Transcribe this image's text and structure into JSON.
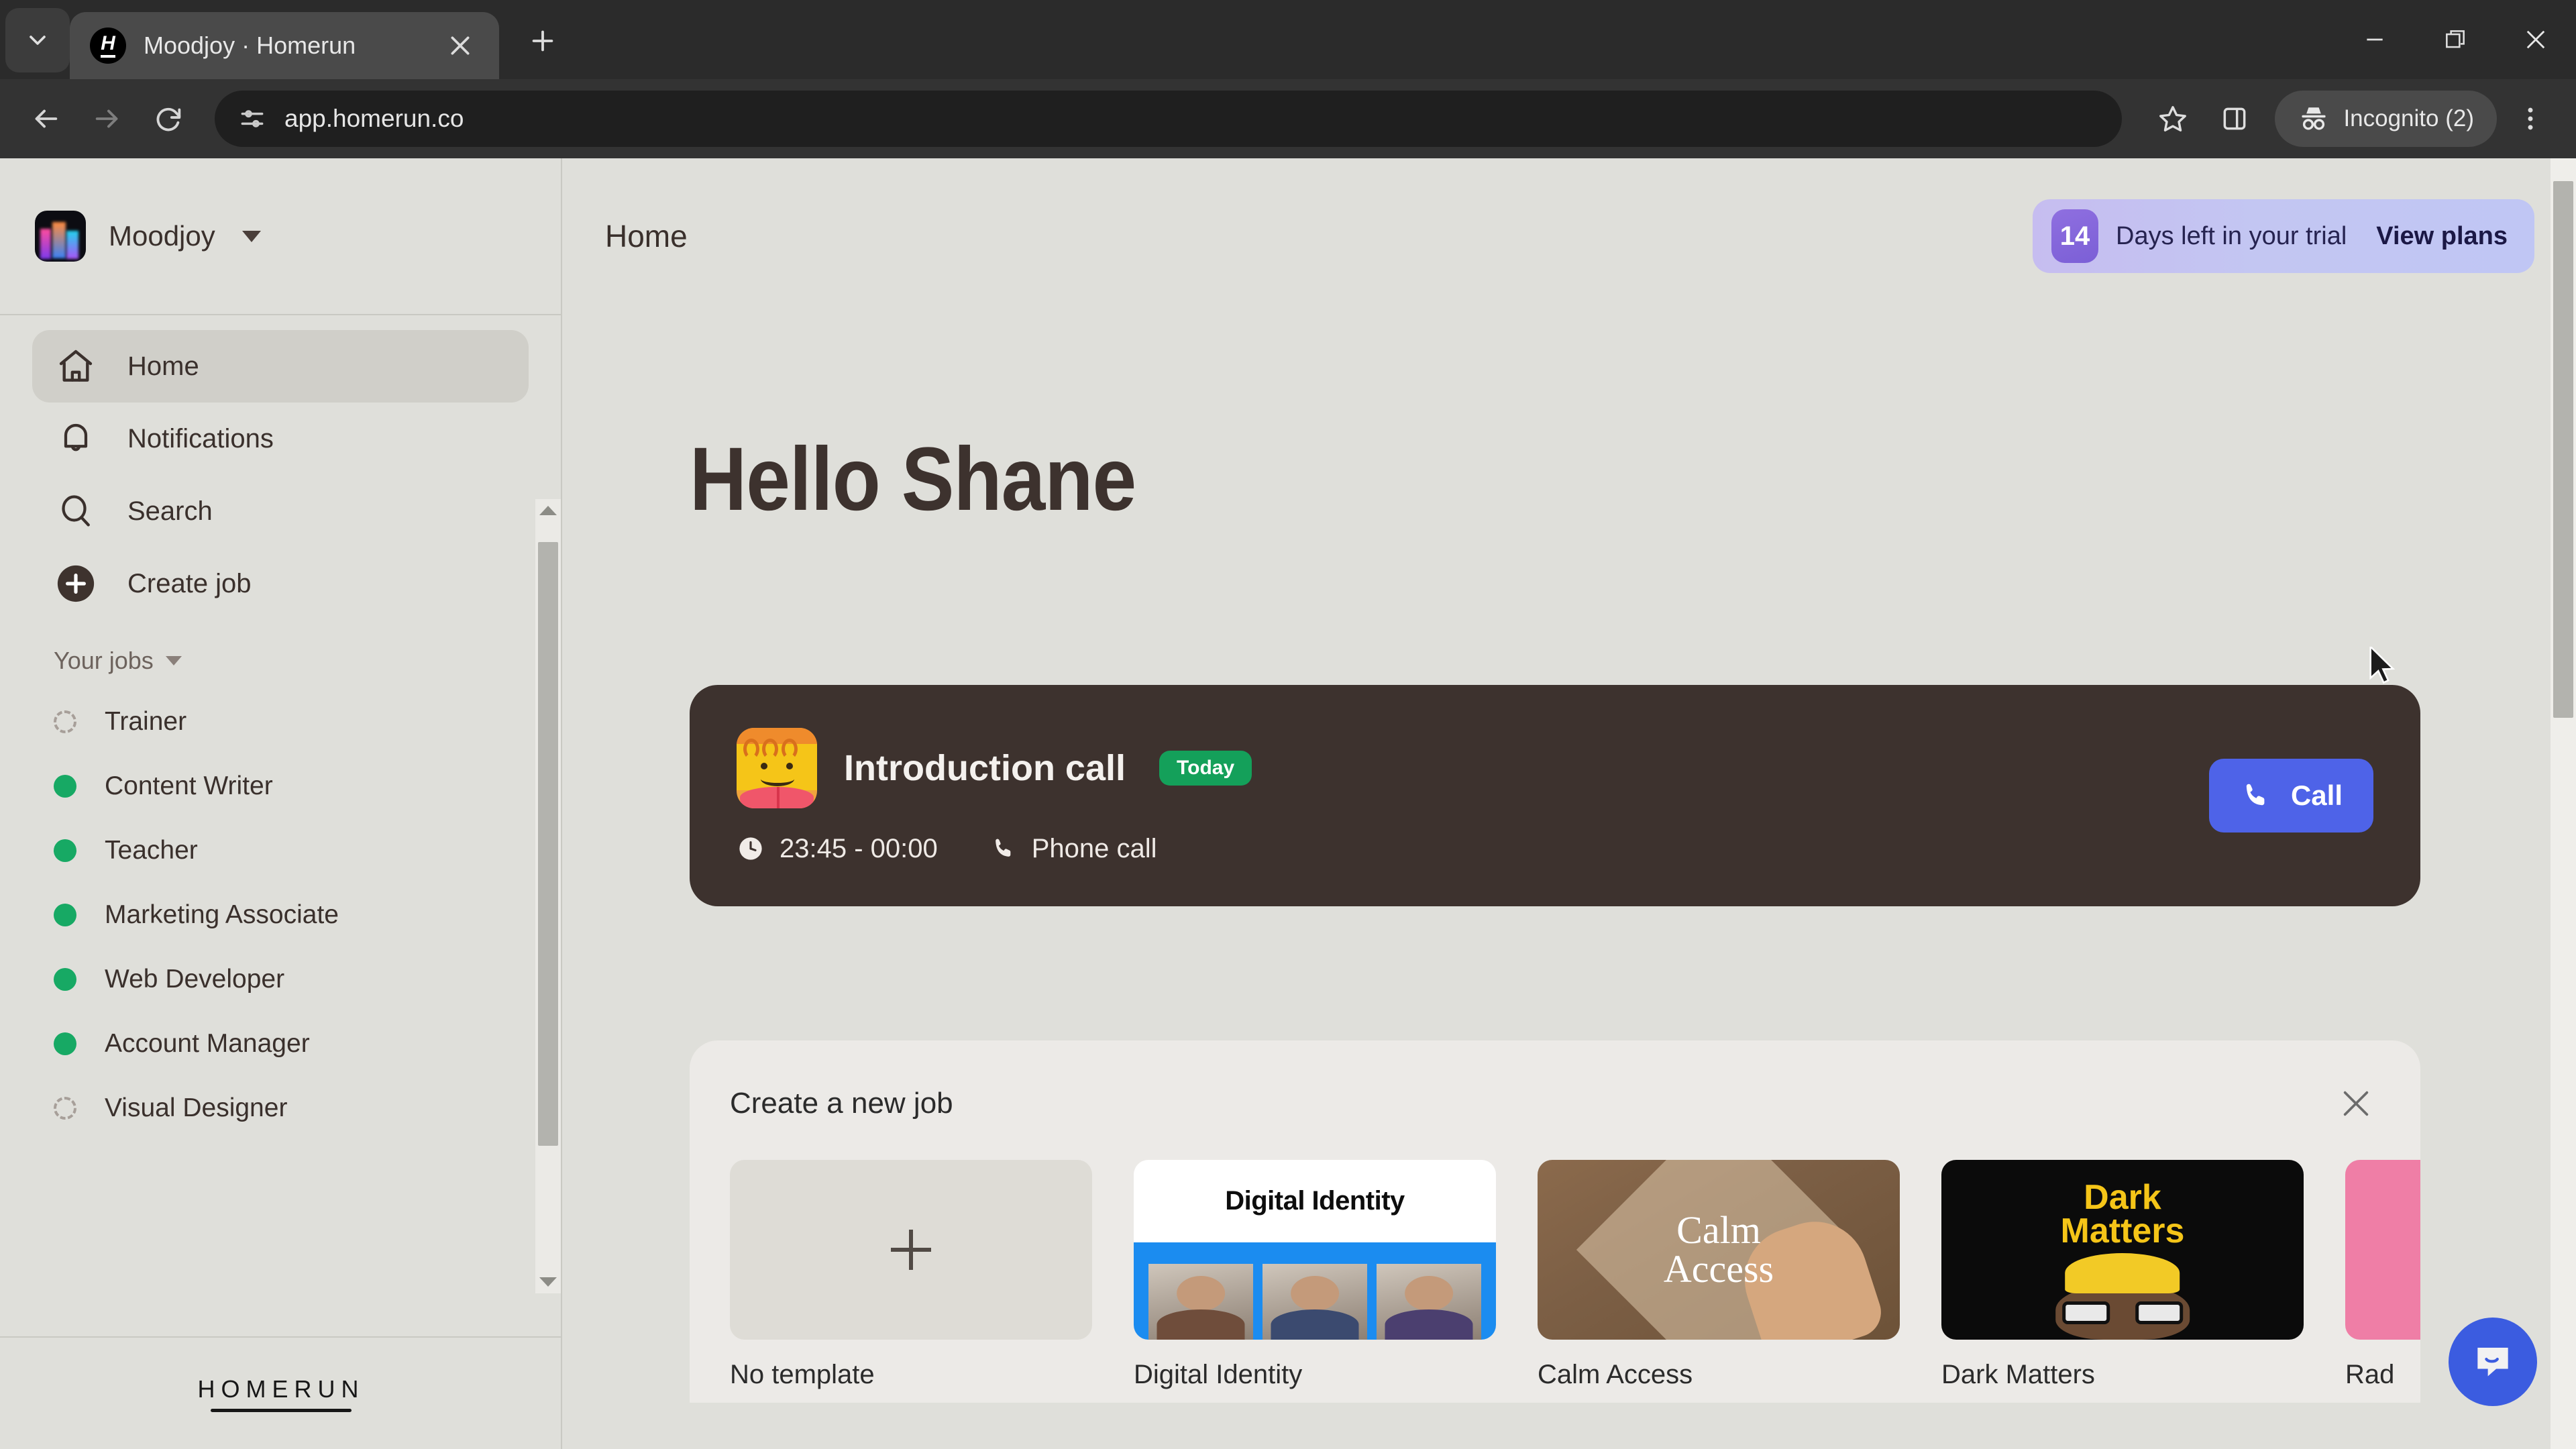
{
  "browser": {
    "tab": {
      "title": "Moodjoy · Homerun",
      "favicon": "H"
    },
    "tab_list_icon": "chevron-down-icon",
    "new_tab_icon": "plus-icon",
    "close_tab_icon": "close-icon",
    "back_icon": "arrow-left-icon",
    "forward_icon": "arrow-right-icon",
    "reload_icon": "reload-icon",
    "site_info_icon": "tune-icon",
    "url": "app.homerun.co",
    "bookmark_icon": "star-icon",
    "side_panel_icon": "side-panel-icon",
    "incognito": {
      "label": "Incognito (2)",
      "icon": "incognito-icon"
    },
    "menu_icon": "three-dot-menu-icon",
    "window": {
      "minimize": "minimize-icon",
      "maximize": "restore-icon",
      "close": "window-close-icon"
    }
  },
  "sidebar": {
    "workspace": {
      "name": "Moodjoy",
      "caret": "chevron-down-icon"
    },
    "nav": [
      {
        "label": "Home",
        "icon": "home-icon",
        "active": true
      },
      {
        "label": "Notifications",
        "icon": "bell-icon",
        "active": false
      },
      {
        "label": "Search",
        "icon": "search-icon",
        "active": false
      },
      {
        "label": "Create job",
        "icon": "plus-circle-icon",
        "active": false
      }
    ],
    "jobs_header": {
      "label": "Your jobs",
      "caret": "chevron-down-icon"
    },
    "jobs": [
      {
        "label": "Trainer",
        "status": "draft"
      },
      {
        "label": "Content Writer",
        "status": "published"
      },
      {
        "label": "Teacher",
        "status": "published"
      },
      {
        "label": "Marketing Associate",
        "status": "published"
      },
      {
        "label": "Web Developer",
        "status": "published"
      },
      {
        "label": "Account Manager",
        "status": "published"
      },
      {
        "label": "Visual Designer",
        "status": "draft"
      }
    ],
    "logo": "HOMERUN"
  },
  "main": {
    "page_title": "Home",
    "trial": {
      "days": "14",
      "text": "Days left in your trial",
      "cta": "View plans"
    },
    "greeting": "Hello Shane",
    "event": {
      "title": "Introduction call",
      "badge": "Today",
      "time": "23:45 - 00:00",
      "type": "Phone call",
      "clock_icon": "clock-icon",
      "phone_icon": "phone-icon",
      "avatar_icon": "person-avatar-icon",
      "call_button": "Call"
    },
    "create_panel": {
      "title": "Create a new job",
      "close_icon": "close-icon",
      "templates": [
        {
          "label": "No template",
          "kind": "empty"
        },
        {
          "label": "Digital Identity",
          "kind": "digital-identity",
          "headline": "Digital Identity"
        },
        {
          "label": "Calm Access",
          "kind": "calm-access",
          "headline_line1": "Calm",
          "headline_line2": "Access"
        },
        {
          "label": "Dark Matters",
          "kind": "dark-matters",
          "headline_line1": "Dark",
          "headline_line2": "Matters"
        },
        {
          "label": "Rad",
          "kind": "rad"
        }
      ]
    },
    "intercom_icon": "chat-bubble-icon"
  },
  "colors": {
    "page_bg": "#dfdfda",
    "accent_blue": "#4e63e8",
    "published_green": "#17a964",
    "badge_green": "#14a05a",
    "dark_card": "#3d322e",
    "trial_purple": "#7b5fd6"
  }
}
